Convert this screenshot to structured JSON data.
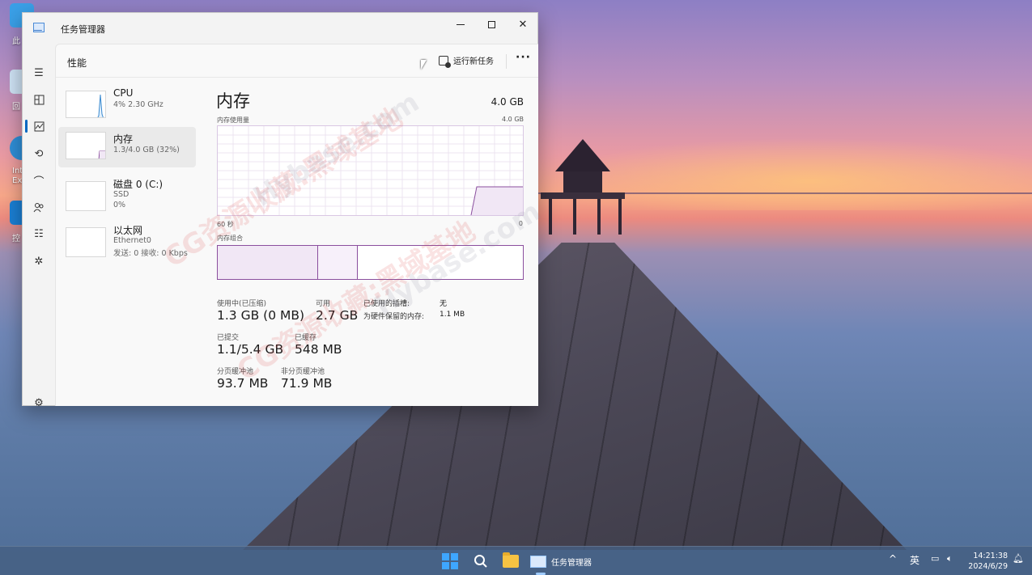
{
  "desktop": {
    "icon_labels": [
      "此",
      "回",
      "Int\nExp",
      "控"
    ]
  },
  "window": {
    "title": "任务管理器",
    "page_title": "性能",
    "run_new_task": "运行新任务",
    "more": "···"
  },
  "devices": [
    {
      "name": "CPU",
      "sub1": "4% 2.30 GHz",
      "sub2": ""
    },
    {
      "name": "内存",
      "sub1": "1.3/4.0 GB (32%)",
      "sub2": ""
    },
    {
      "name": "磁盘 0 (C:)",
      "sub1": "SSD",
      "sub2": "0%"
    },
    {
      "name": "以太网",
      "sub1": "Ethernet0",
      "sub2": "发送: 0 接收: 0 Kbps"
    }
  ],
  "memory": {
    "title": "内存",
    "total": "4.0 GB",
    "usage_label": "内存使用量",
    "usage_max": "4.0 GB",
    "time_left": "60 秒",
    "time_right": "0",
    "composition_label": "内存组合",
    "composition": {
      "in_use": 0.33,
      "modified": 0.13,
      "standby": 0.54
    },
    "stats": {
      "in_use_label": "使用中(已压缩)",
      "in_use_value": "1.3 GB (0 MB)",
      "available_label": "可用",
      "available_value": "2.7 GB",
      "committed_label": "已提交",
      "committed_value": "1.1/5.4 GB",
      "cached_label": "已缓存",
      "cached_value": "548 MB",
      "paged_label": "分页缓冲池",
      "paged_value": "93.7 MB",
      "nonpaged_label": "非分页缓冲池",
      "nonpaged_value": "71.9 MB",
      "slots_label": "已使用的插槽:",
      "slots_value": "无",
      "reserved_label": "为硬件保留的内存:",
      "reserved_value": "1.1 MB"
    }
  },
  "watermark": {
    "text1": "CG资源收藏:黑域基地",
    "text2": "Hybase.com"
  },
  "taskbar": {
    "task_label": "任务管理器",
    "ime": "英",
    "time": "14:21:38",
    "date": "2024/6/29"
  },
  "colors": {
    "accent": "#0067c0",
    "memory_line": "#8b4f9e",
    "memory_fill": "#f1e7f5"
  }
}
